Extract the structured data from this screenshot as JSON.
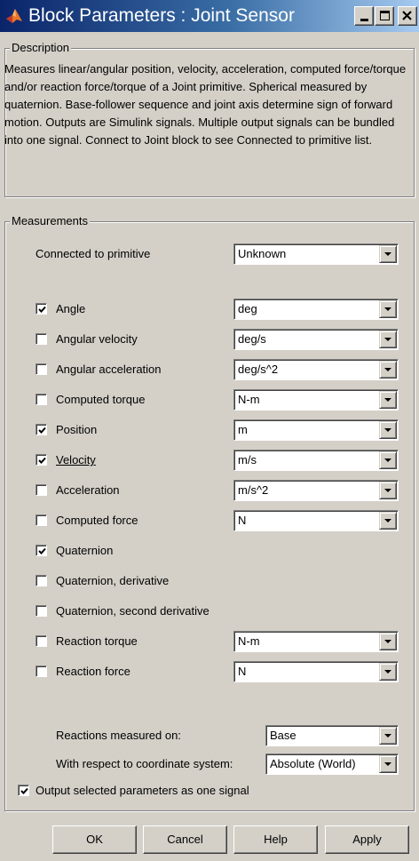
{
  "window": {
    "title": "Block Parameters : Joint Sensor"
  },
  "description": {
    "legend": "Description",
    "text": "Measures linear/angular position, velocity, acceleration, computed force/torque and/or reaction force/torque of a Joint primitive. Spherical measured by quaternion. Base-follower sequence and joint axis determine sign of forward motion. Outputs are Simulink signals. Multiple output signals can be bundled into one signal. Connect to Joint block to see Connected to primitive list."
  },
  "measurements": {
    "legend": "Measurements",
    "connected_label": "Connected to primitive",
    "connected_value": "Unknown",
    "items": [
      {
        "label": "Angle",
        "checked": true,
        "unit": "deg"
      },
      {
        "label": "Angular velocity",
        "checked": false,
        "unit": "deg/s"
      },
      {
        "label": "Angular acceleration",
        "checked": false,
        "unit": "deg/s^2"
      },
      {
        "label": "Computed torque",
        "checked": false,
        "unit": "N-m"
      },
      {
        "label": "Position",
        "checked": true,
        "unit": "m"
      },
      {
        "label": "Velocity",
        "checked": true,
        "unit": "m/s"
      },
      {
        "label": "Acceleration",
        "checked": false,
        "unit": "m/s^2"
      },
      {
        "label": "Computed force",
        "checked": false,
        "unit": "N"
      },
      {
        "label": "Quaternion",
        "checked": true
      },
      {
        "label": "Quaternion, derivative",
        "checked": false
      },
      {
        "label": "Quaternion, second derivative",
        "checked": false
      },
      {
        "label": "Reaction torque",
        "checked": false,
        "unit": "N-m"
      },
      {
        "label": "Reaction force",
        "checked": false,
        "unit": "N"
      }
    ],
    "reactions_label": "Reactions measured on:",
    "reactions_value": "Base",
    "coord_label": "With respect to coordinate system:",
    "coord_value": "Absolute (World)"
  },
  "output_option": {
    "label": "Output selected parameters as one signal",
    "checked": true
  },
  "buttons": {
    "ok": "OK",
    "cancel": "Cancel",
    "help": "Help",
    "apply": "Apply"
  }
}
